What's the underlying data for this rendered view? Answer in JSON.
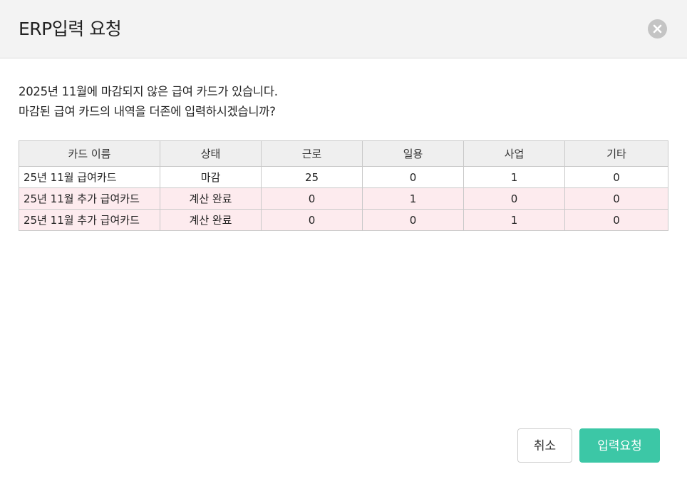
{
  "dialog": {
    "title": "ERP입력 요청",
    "close_icon": "close-icon",
    "message_line1": "2025년 11월에 마감되지 않은 급여 카드가 있습니다.",
    "message_line2": "마감된 급여 카드의 내역을 더존에 입력하시겠습니까?"
  },
  "table": {
    "headers": [
      "카드 이름",
      "상태",
      "근로",
      "일용",
      "사업",
      "기타"
    ],
    "rows": [
      {
        "name": "25년 11월 급여카드",
        "status": "마감",
        "work": "25",
        "daily": "0",
        "business": "1",
        "other": "0",
        "highlight": false
      },
      {
        "name": "25년 11월 추가 급여카드",
        "status": "계산 완료",
        "work": "0",
        "daily": "1",
        "business": "0",
        "other": "0",
        "highlight": true
      },
      {
        "name": "25년 11월 추가 급여카드",
        "status": "계산 완료",
        "work": "0",
        "daily": "0",
        "business": "1",
        "other": "0",
        "highlight": true
      }
    ]
  },
  "buttons": {
    "cancel_label": "취소",
    "submit_label": "입력요청"
  },
  "colors": {
    "accent": "#3cc7a6",
    "highlight_row": "#fdebee",
    "header_bg": "#f3f3f3"
  }
}
